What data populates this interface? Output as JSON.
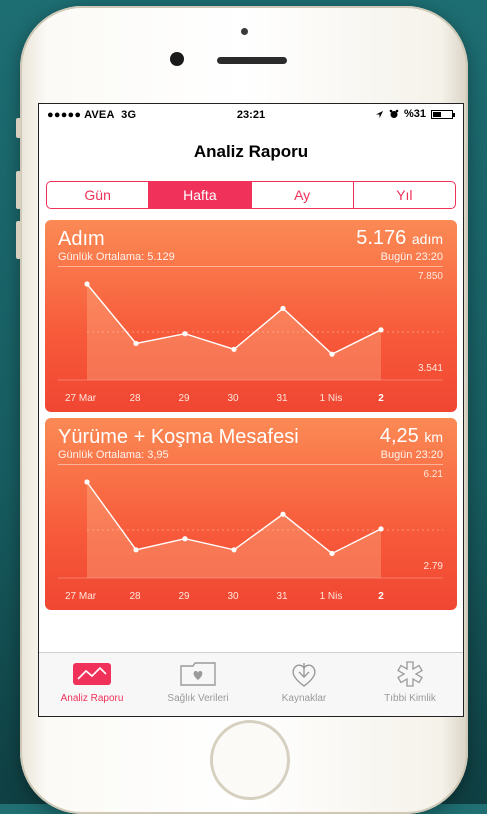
{
  "status_bar": {
    "carrier": "●●●●● AVEA",
    "network": "3G",
    "time": "23:21",
    "battery": "%31"
  },
  "nav": {
    "title": "Analiz Raporu"
  },
  "segments": [
    {
      "label": "Gün",
      "active": false
    },
    {
      "label": "Hafta",
      "active": true
    },
    {
      "label": "Ay",
      "active": false
    },
    {
      "label": "Yıl",
      "active": false
    }
  ],
  "cards": [
    {
      "title": "Adım",
      "value": "5.176",
      "unit": "adım",
      "avg": "Günlük Ortalama: 5.129",
      "today": "Bugün 23:20",
      "max_label": "7.850",
      "min_label": "3.541",
      "chart_data": {
        "type": "area",
        "categories": [
          "27 Mar",
          "28",
          "29",
          "30",
          "31",
          "1 Nis",
          "2"
        ],
        "values": [
          7850,
          4800,
          5300,
          4500,
          6600,
          4250,
          5500
        ],
        "ylim": [
          3541,
          7850
        ],
        "xlabel": "",
        "ylabel": ""
      }
    },
    {
      "title": "Yürüme + Koşma Mesafesi",
      "value": "4,25",
      "unit": "km",
      "avg": "Günlük Ortalama: 3,95",
      "today": "Bugün 23:20",
      "max_label": "6.21",
      "min_label": "2.79",
      "chart_data": {
        "type": "area",
        "categories": [
          "27 Mar",
          "28",
          "29",
          "30",
          "31",
          "1 Nis",
          "2"
        ],
        "values": [
          6.21,
          3.45,
          3.9,
          3.45,
          4.9,
          3.3,
          4.3
        ],
        "ylim": [
          2.79,
          6.21
        ],
        "xlabel": "",
        "ylabel": ""
      }
    }
  ],
  "tabs": [
    {
      "label": "Analiz Raporu",
      "icon": "chart-icon",
      "active": true
    },
    {
      "label": "Sağlık Verileri",
      "icon": "folder-heart-icon",
      "active": false
    },
    {
      "label": "Kaynaklar",
      "icon": "download-heart-icon",
      "active": false
    },
    {
      "label": "Tıbbi Kimlik",
      "icon": "medical-star-icon",
      "active": false
    }
  ],
  "colors": {
    "accent": "#f0315a",
    "card_top": "#fb8a55",
    "card_bottom": "#f04632"
  }
}
